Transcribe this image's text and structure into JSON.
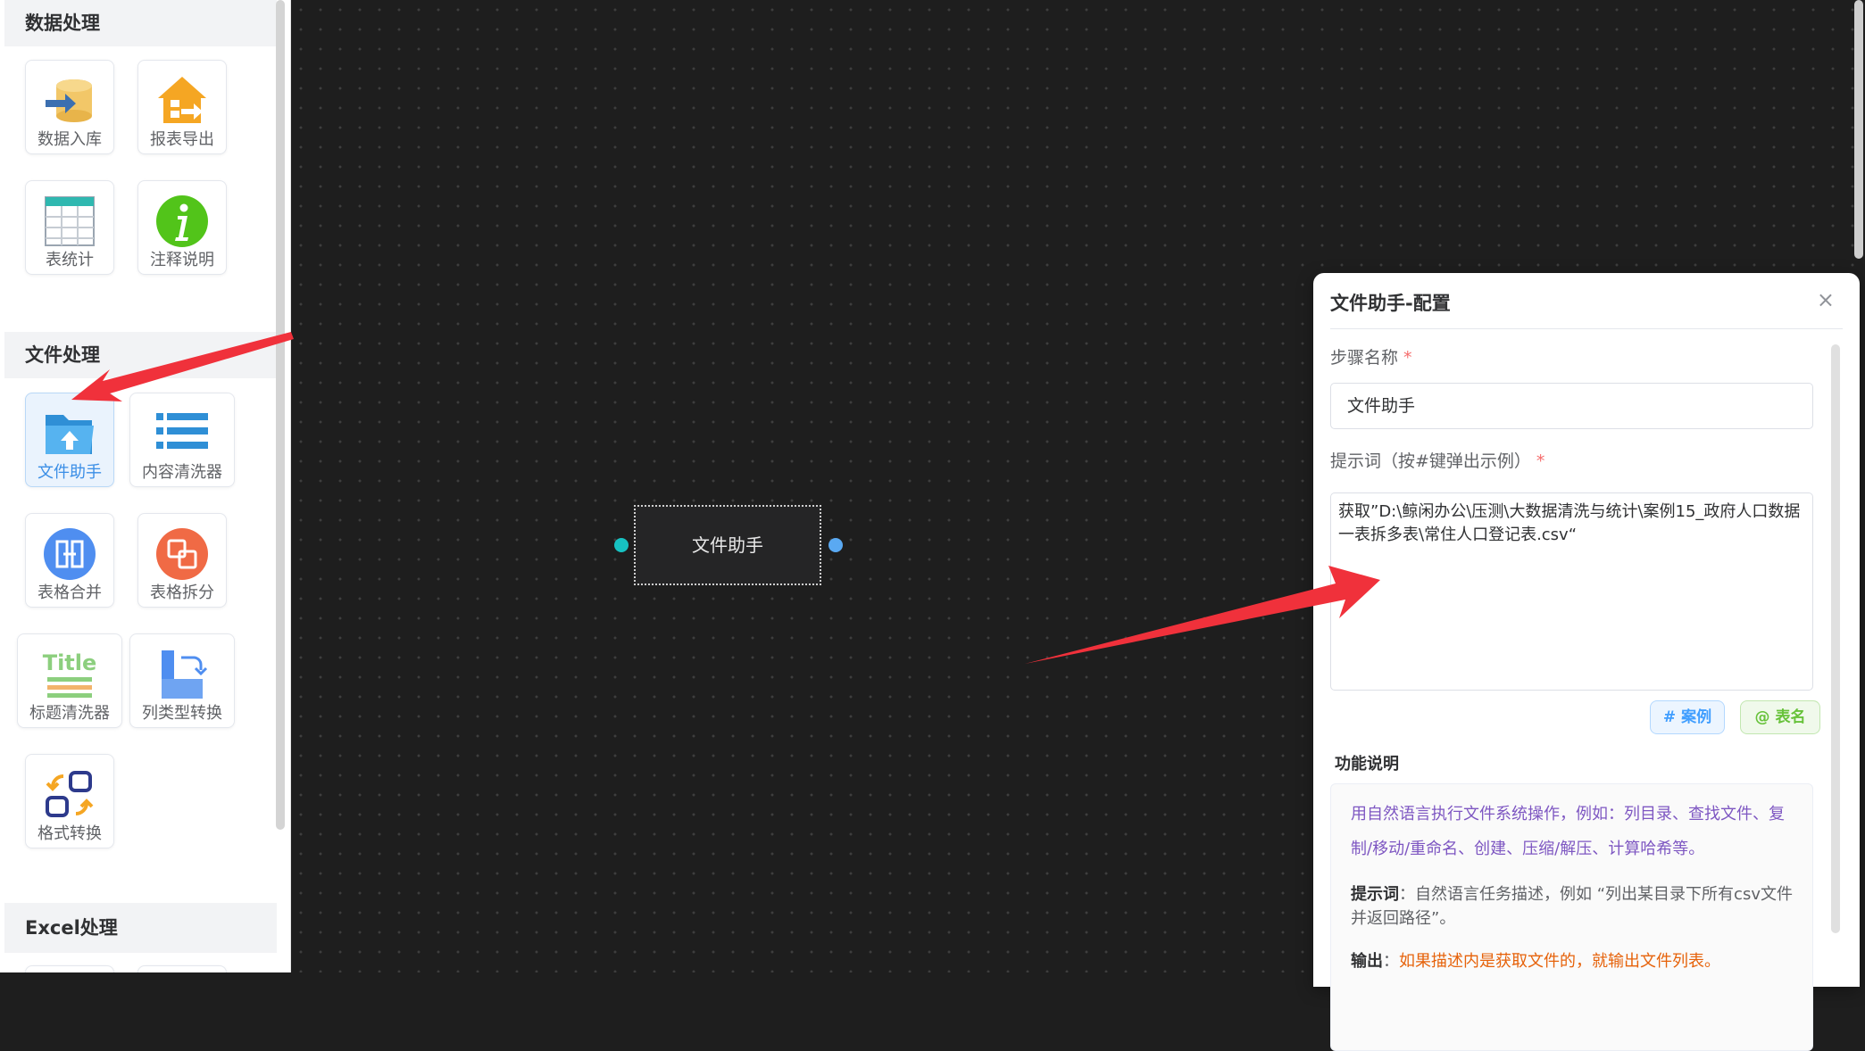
{
  "sidebar": {
    "categories": [
      {
        "title": "数据处理"
      },
      {
        "title": "文件处理"
      },
      {
        "title": "Excel处理"
      }
    ],
    "tools": {
      "data_import": "数据入库",
      "report_export": "报表导出",
      "table_stats": "表统计",
      "comment_note": "注释说明",
      "file_helper": "文件助手",
      "content_cleaner": "内容清洗器",
      "table_merge": "表格合并",
      "table_split": "表格拆分",
      "title_cleaner": "标题清洗器",
      "column_type_convert": "列类型转换",
      "format_convert": "格式转换"
    },
    "title_icon_text": "Title"
  },
  "canvas": {
    "node_label": "文件助手"
  },
  "panel": {
    "title": "文件助手-配置",
    "close": "×",
    "step_name_label": "步骤名称",
    "required_mark": "*",
    "step_name_value": "文件助手",
    "prompt_label": "提示词（按#键弹出示例）",
    "prompt_value": "获取”D:\\鲸闲办公\\压测\\大数据清洗与统计\\案例15_政府人口数据一表拆多表\\常住人口登记表.csv“",
    "btn_case": "# 案例",
    "btn_table": "@ 表名",
    "func_title": "功能说明",
    "func_desc": "用自然语言执行文件系统操作，例如：列目录、查找文件、复制/移动/重命名、创建、压缩/解压、计算哈希等。",
    "func_prompt_key": "提示词",
    "func_prompt_text": "：自然语言任务描述，例如 “列出某目录下所有csv文件并返回路径”。",
    "func_output_key": "输出",
    "func_output_sep": "：",
    "func_output_text": "如果描述内是获取文件的，就输出文件列表。"
  },
  "colors": {
    "accent_blue": "#409eff",
    "accent_green": "#67c23a",
    "annotation_arrow": "#f0313b",
    "port_in": "#17c2c2",
    "port_out": "#5aa9f2"
  }
}
